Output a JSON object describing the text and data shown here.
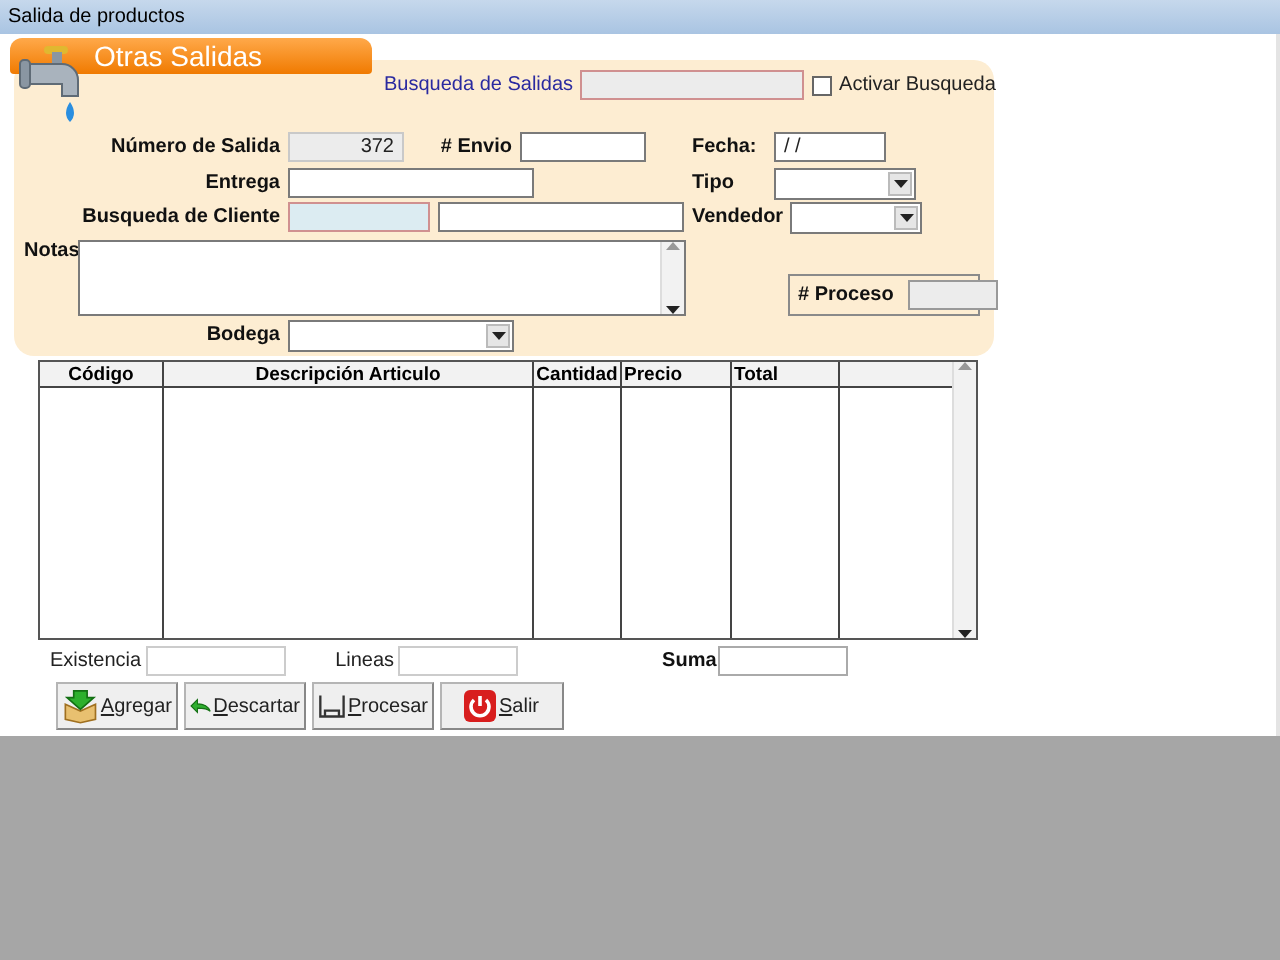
{
  "window": {
    "title": "Salida de productos"
  },
  "header": {
    "title": "Otras Salidas"
  },
  "search": {
    "label": "Busqueda de Salidas",
    "disabled": true,
    "checkbox": {
      "label": "Activar Busqueda",
      "checked": false
    }
  },
  "numero_salida": {
    "label": "Número de Salida",
    "value": "372",
    "disabled": true
  },
  "envio": {
    "label": "# Envio"
  },
  "fecha": {
    "label": "Fecha:",
    "value": "/ /"
  },
  "entrega": {
    "label": "Entrega"
  },
  "tipo": {
    "label": "Tipo"
  },
  "busqueda_cliente": {
    "label": "Busqueda de Cliente"
  },
  "vendedor": {
    "label": "Vendedor"
  },
  "notas": {
    "label": "Notas"
  },
  "proceso": {
    "label": "# Proceso",
    "disabled": true
  },
  "bodega": {
    "label": "Bodega"
  },
  "table": {
    "columns": [
      "Código",
      "Descripción Articulo",
      "Cantidad",
      "Precio",
      "Total"
    ]
  },
  "existencia": {
    "label": "Existencia"
  },
  "lineas": {
    "label": "Lineas"
  },
  "suma": {
    "label": "Suma"
  },
  "buttons": [
    {
      "label": "Agregar",
      "kind": "add"
    },
    {
      "label": "Descartar",
      "kind": "discard"
    },
    {
      "label": "Procesar",
      "kind": "process"
    },
    {
      "label": "Salir",
      "kind": "exit"
    }
  ]
}
